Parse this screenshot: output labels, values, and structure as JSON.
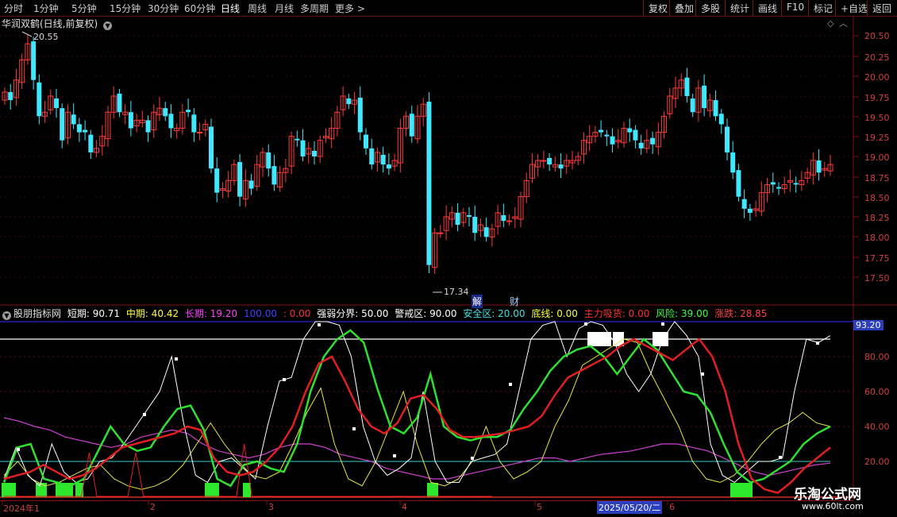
{
  "toolbar": {
    "periods": [
      "分时",
      "1分钟",
      "5分钟",
      "15分钟",
      "30分钟",
      "60分钟",
      "日线",
      "周线",
      "月线",
      "多周期",
      "更多"
    ],
    "right_buttons": [
      "复权",
      "叠加",
      "多股",
      "统计",
      "画线",
      "F10",
      "标记",
      "+自选",
      "返回"
    ]
  },
  "main": {
    "title": "华润双鹤(日线,前复权)",
    "high_label": "20.55",
    "low_label": "17.34",
    "badge_jie": "解",
    "badge_cai": "财",
    "y_ticks": [
      "20.50",
      "20.25",
      "20.00",
      "19.75",
      "19.50",
      "19.25",
      "19.00",
      "18.75",
      "18.50",
      "18.25",
      "18.00",
      "17.75",
      "17.50"
    ]
  },
  "indicator": {
    "name": "股朋指标网",
    "items": [
      {
        "label": "短期: 90.71",
        "color": "#ffffff"
      },
      {
        "label": "中期: 40.42",
        "color": "#ffff40"
      },
      {
        "label": "长期: 19.20",
        "color": "#ff40ff"
      },
      {
        "label": "100.00",
        "color": "#4040ff"
      },
      {
        "label": ": 0.00",
        "color": "#ff3030"
      },
      {
        "label": "强弱分界: 50.00",
        "color": "#ffffff"
      },
      {
        "label": "警戒区: 90.00",
        "color": "#ffffff"
      },
      {
        "label": "安全区: 20.00",
        "color": "#40e0e0"
      },
      {
        "label": "底线: 0.00",
        "color": "#ffff40"
      },
      {
        "label": "主力吸货: 0.00",
        "color": "#ff3030"
      },
      {
        "label": "风险: 39.00",
        "color": "#40ff40"
      },
      {
        "label": "涨跌: 28.85",
        "color": "#ff4040"
      }
    ],
    "y_ticks": [
      "100.00",
      "80.00",
      "60.00",
      "40.00",
      "20.00"
    ],
    "value_tag": "93.20"
  },
  "x_axis": {
    "labels": [
      "2024年1",
      "2",
      "3",
      "4",
      "5",
      "6"
    ],
    "date_tag": "2025/05/20/二"
  },
  "brand": {
    "name": "乐淘公式网",
    "url": "www.60lt.com"
  },
  "colors": {
    "up": "#ff3a3a",
    "down": "#40e8ff",
    "grid": "#7a1010",
    "axis_text": "#d04040"
  }
}
